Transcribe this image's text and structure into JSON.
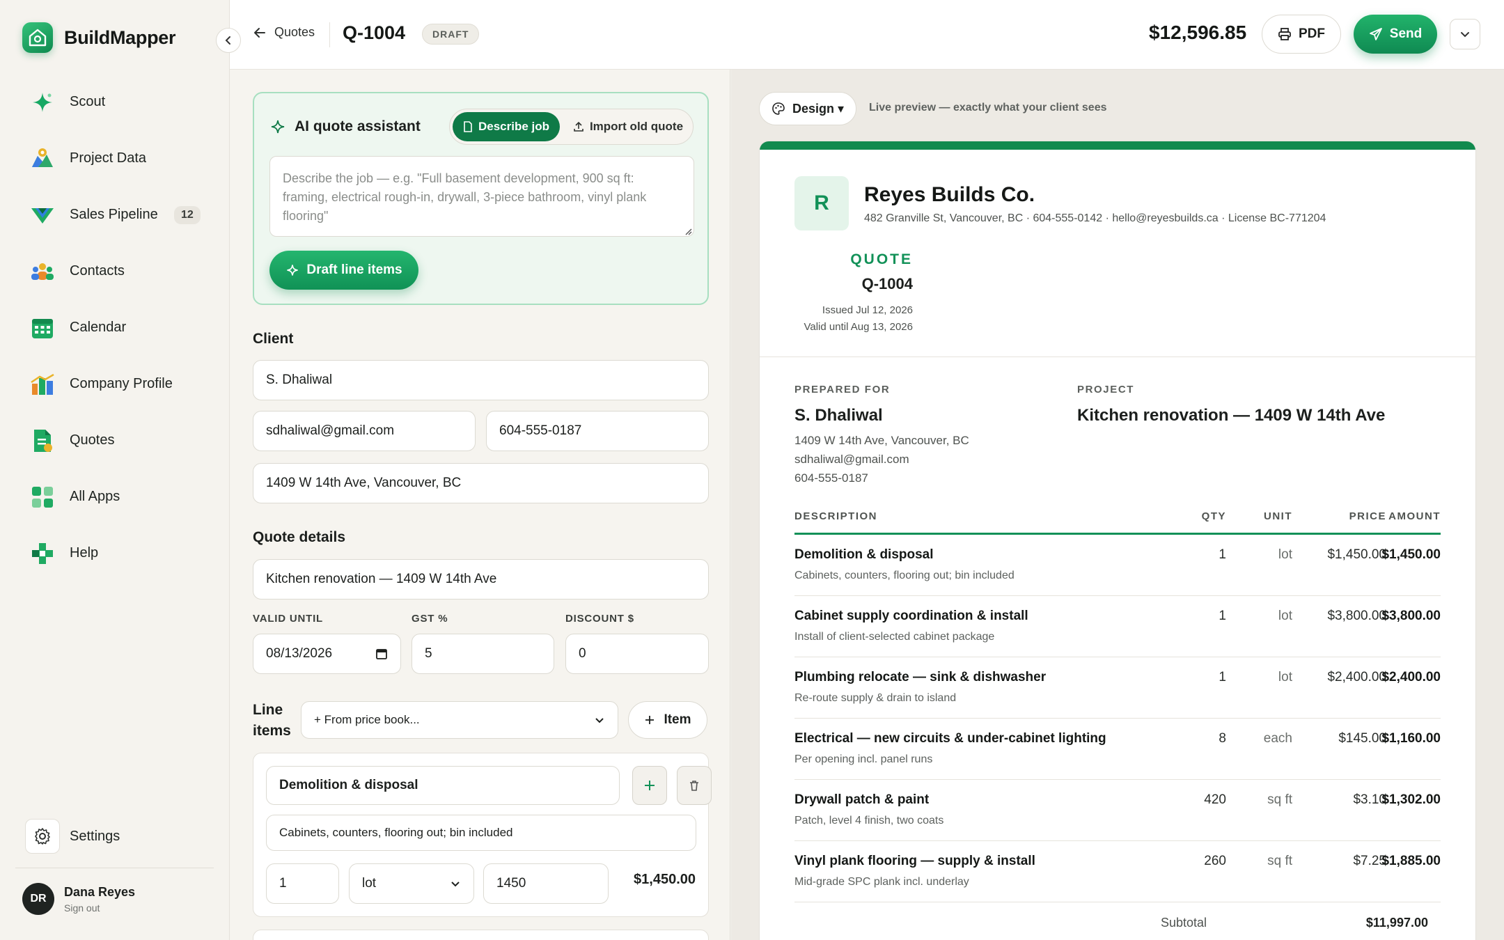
{
  "brand": {
    "name": "BuildMapper"
  },
  "sidebar": {
    "items": [
      {
        "label": "Scout",
        "icon": "sparkle-icon"
      },
      {
        "label": "Project Data",
        "icon": "map-icon"
      },
      {
        "label": "Sales Pipeline",
        "icon": "funnel-icon",
        "badge": "12"
      },
      {
        "label": "Contacts",
        "icon": "people-icon"
      },
      {
        "label": "Calendar",
        "icon": "calendar-icon"
      },
      {
        "label": "Company Profile",
        "icon": "bar-chart-icon"
      },
      {
        "label": "Quotes",
        "icon": "document-icon"
      },
      {
        "label": "All Apps",
        "icon": "grid-icon"
      },
      {
        "label": "Help",
        "icon": "help-icon"
      }
    ],
    "settings_label": "Settings",
    "user": {
      "initials": "DR",
      "name": "Dana Reyes",
      "sub": "Sign out"
    }
  },
  "topbar": {
    "back_label": "Quotes",
    "quote_number": "Q-1004",
    "status": "DRAFT",
    "total": "$12,596.85",
    "pdf_label": "PDF",
    "send_label": "Send"
  },
  "editor": {
    "ai": {
      "title": "AI quote assistant",
      "tab_describe": "Describe job",
      "tab_import": "Import old quote",
      "placeholder": "Describe the job — e.g. \"Full basement development, 900 sq ft: framing, electrical rough-in, drywall, 3-piece bathroom, vinyl plank flooring\"",
      "draft_label": "Draft line items"
    },
    "client": {
      "title": "Client",
      "name": "S. Dhaliwal",
      "email": "sdhaliwal@gmail.com",
      "phone": "604-555-0187",
      "address": "1409 W 14th Ave, Vancouver, BC"
    },
    "details": {
      "title": "Quote details",
      "project": "Kitchen renovation — 1409 W 14th Ave",
      "valid_label": "VALID UNTIL",
      "valid_value": "08/13/2026",
      "gst_label": "GST %",
      "gst_value": "5",
      "discount_label": "DISCOUNT $",
      "discount_value": "0"
    },
    "line_items": {
      "title": "Line items",
      "price_book": "+ From price book...",
      "add_item": "Item",
      "first": {
        "name": "Demolition & disposal",
        "desc": "Cabinets, counters, flooring out; bin included",
        "qty": "1",
        "unit": "lot",
        "price": "1450",
        "amount": "$1,450.00"
      }
    }
  },
  "preview": {
    "design_label": "Design ▾",
    "note": "Live preview — exactly what your client sees",
    "company": {
      "initial": "R",
      "name": "Reyes Builds Co.",
      "info": "482 Granville St, Vancouver, BC · 604-555-0142 · hello@reyesbuilds.ca · License BC-771204"
    },
    "quote_label": "QUOTE",
    "quote_number": "Q-1004",
    "issued": "Issued Jul 12, 2026",
    "valid": "Valid until Aug 13, 2026",
    "prepared_label": "PREPARED FOR",
    "client_name": "S. Dhaliwal",
    "client_address": "1409 W 14th Ave, Vancouver, BC",
    "client_email": "sdhaliwal@gmail.com",
    "client_phone": "604-555-0187",
    "project_label": "PROJECT",
    "project_name": "Kitchen renovation — 1409 W 14th Ave",
    "headers": {
      "desc": "DESCRIPTION",
      "qty": "QTY",
      "unit": "UNIT",
      "price": "PRICE",
      "amount": "AMOUNT"
    },
    "rows": [
      {
        "desc": "Demolition & disposal",
        "sub": "Cabinets, counters, flooring out; bin included",
        "qty": "1",
        "unit": "lot",
        "price": "$1,450.00",
        "amount": "$1,450.00"
      },
      {
        "desc": "Cabinet supply coordination & install",
        "sub": "Install of client-selected cabinet package",
        "qty": "1",
        "unit": "lot",
        "price": "$3,800.00",
        "amount": "$3,800.00"
      },
      {
        "desc": "Plumbing relocate — sink & dishwasher",
        "sub": "Re-route supply & drain to island",
        "qty": "1",
        "unit": "lot",
        "price": "$2,400.00",
        "amount": "$2,400.00"
      },
      {
        "desc": "Electrical — new circuits & under-cabinet lighting",
        "sub": "Per opening incl. panel runs",
        "qty": "8",
        "unit": "each",
        "price": "$145.00",
        "amount": "$1,160.00"
      },
      {
        "desc": "Drywall patch & paint",
        "sub": "Patch, level 4 finish, two coats",
        "qty": "420",
        "unit": "sq ft",
        "price": "$3.10",
        "amount": "$1,302.00"
      },
      {
        "desc": "Vinyl plank flooring — supply & install",
        "sub": "Mid-grade SPC plank incl. underlay",
        "qty": "260",
        "unit": "sq ft",
        "price": "$7.25",
        "amount": "$1,885.00"
      }
    ],
    "subtotal_label": "Subtotal",
    "subtotal_value": "$11,997.00"
  }
}
